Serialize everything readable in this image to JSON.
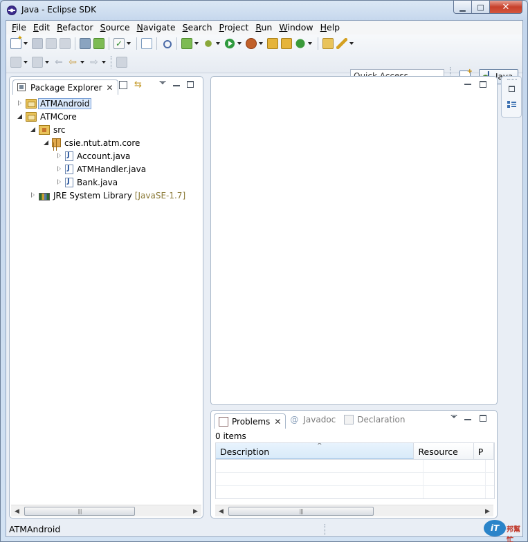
{
  "window": {
    "title": "Java - Eclipse SDK",
    "min_glyph": "▁",
    "max_glyph": "□",
    "close_glyph": "✕"
  },
  "menu": [
    "File",
    "Edit",
    "Refactor",
    "Source",
    "Navigate",
    "Search",
    "Project",
    "Run",
    "Window",
    "Help"
  ],
  "toolbar": {
    "quick_access_placeholder": "Quick Access",
    "perspective": "Java"
  },
  "package_explorer": {
    "tab_label": "Package Explorer",
    "close_glyph": "✕",
    "tree": [
      {
        "label": "ATMAndroid",
        "icon": "project-icon",
        "level": 0,
        "state": "collapsed",
        "selected": true
      },
      {
        "label": "ATMCore",
        "icon": "project-icon",
        "level": 0,
        "state": "expanded"
      },
      {
        "label": "src",
        "icon": "source-folder-icon",
        "level": 1,
        "state": "expanded"
      },
      {
        "label": "csie.ntut.atm.core",
        "icon": "package-icon",
        "level": 2,
        "state": "expanded"
      },
      {
        "label": "Account.java",
        "icon": "java-file-icon",
        "level": 3,
        "state": "collapsed"
      },
      {
        "label": "ATMHandler.java",
        "icon": "java-file-icon",
        "level": 3,
        "state": "collapsed"
      },
      {
        "label": "Bank.java",
        "icon": "java-file-icon",
        "level": 3,
        "state": "collapsed"
      },
      {
        "label": "JRE System Library",
        "decoration": "[JavaSE-1.7]",
        "icon": "library-icon",
        "level": 1,
        "state": "collapsed"
      }
    ]
  },
  "problems_view": {
    "tabs": [
      {
        "label": "Problems",
        "active": true,
        "icon": "problems-icon"
      },
      {
        "label": "Javadoc",
        "active": false,
        "icon": "javadoc-icon",
        "glyph": "@"
      },
      {
        "label": "Declaration",
        "active": false,
        "icon": "declaration-icon"
      }
    ],
    "close_glyph": "✕",
    "item_count": "0 items",
    "columns": [
      "Description",
      "Resource",
      "P"
    ],
    "sort_indicator": "^"
  },
  "scrollbar": {
    "left_glyph": "◀",
    "right_glyph": "▶",
    "grip_glyph": "|||"
  },
  "statusbar": {
    "text": "ATMAndroid"
  },
  "watermark": {
    "logo_text": "iT",
    "text": "邦幫忙"
  },
  "colors": {
    "selection_bg": "#d9e8fb",
    "decoration": "#8b7a38",
    "titlebar": "#c4d6ec"
  }
}
